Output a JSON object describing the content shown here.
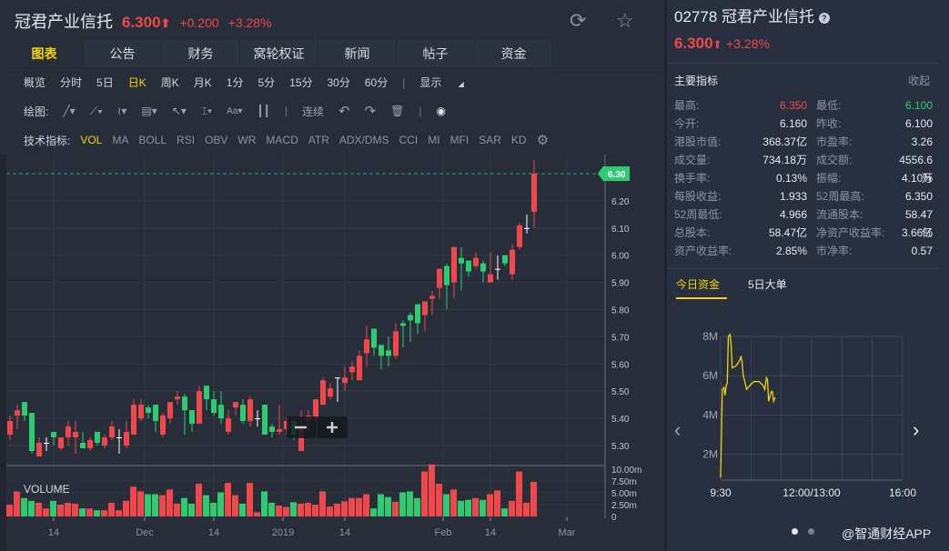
{
  "header": {
    "name": "冠君产业信托",
    "price": "6.300",
    "arrow": "⬆",
    "change": "+0.200",
    "pct": "+3.28%"
  },
  "tabs": [
    "图表",
    "公告",
    "财务",
    "窝轮权证",
    "新闻",
    "帖子",
    "资金"
  ],
  "periods": [
    "概览",
    "分时",
    "5日",
    "日K",
    "周K",
    "月K",
    "1分",
    "5分",
    "15分",
    "30分",
    "60分"
  ],
  "display_label": "显示",
  "draw": {
    "label": "绘图:",
    "continuous": "连续"
  },
  "indicators": {
    "label": "技术指标:",
    "items": [
      "VOL",
      "MA",
      "BOLL",
      "RSI",
      "OBV",
      "WR",
      "MACD",
      "ATR",
      "ADX/DMS",
      "CCI",
      "MI",
      "MFI",
      "SAR",
      "KD"
    ]
  },
  "colors": {
    "up": "#f0474a",
    "down": "#2ecc71",
    "accent": "#f5d200"
  },
  "chart_data": {
    "type": "candlestick",
    "current_price_tag": "6.30",
    "y_ticks": [
      "6.20",
      "6.10",
      "6.00",
      "5.90",
      "5.80",
      "5.70",
      "5.60",
      "5.50",
      "5.40",
      "5.30"
    ],
    "x_ticks": [
      {
        "label": "14",
        "at": 6
      },
      {
        "label": "Dec",
        "at": 18.5
      },
      {
        "label": "14",
        "at": 28
      },
      {
        "label": "2019",
        "at": 37.5
      },
      {
        "label": "14",
        "at": 46
      },
      {
        "label": "Feb",
        "at": 59.5
      },
      {
        "label": "14",
        "at": 66
      },
      {
        "label": "Mar",
        "at": 76.5
      }
    ],
    "volume_label": "VOLUME",
    "volume_ticks": [
      "10.00m",
      "7.50m",
      "5.00m",
      "2.50m",
      "0"
    ],
    "ohlc": [
      [
        5.34,
        5.41,
        5.32,
        5.39
      ],
      [
        5.41,
        5.45,
        5.36,
        5.43
      ],
      [
        5.46,
        5.46,
        5.39,
        5.41
      ],
      [
        5.42,
        5.42,
        5.27,
        5.28
      ],
      [
        5.26,
        5.33,
        5.26,
        5.31
      ],
      [
        5.31,
        5.33,
        5.28,
        5.31
      ],
      [
        5.35,
        5.35,
        5.3,
        5.33
      ],
      [
        5.29,
        5.33,
        5.28,
        5.33
      ],
      [
        5.33,
        5.39,
        5.3,
        5.37
      ],
      [
        5.33,
        5.39,
        5.27,
        5.35
      ],
      [
        5.31,
        5.35,
        5.29,
        5.29
      ],
      [
        5.29,
        5.33,
        5.28,
        5.32
      ],
      [
        5.35,
        5.35,
        5.3,
        5.31
      ],
      [
        5.3,
        5.34,
        5.29,
        5.33
      ],
      [
        5.33,
        5.39,
        5.32,
        5.37
      ],
      [
        5.33,
        5.36,
        5.27,
        5.33
      ],
      [
        5.3,
        5.39,
        5.29,
        5.35
      ],
      [
        5.34,
        5.47,
        5.34,
        5.45
      ],
      [
        5.4,
        5.47,
        5.39,
        5.45
      ],
      [
        5.44,
        5.45,
        5.4,
        5.42
      ],
      [
        5.45,
        5.45,
        5.35,
        5.39
      ],
      [
        5.34,
        5.42,
        5.33,
        5.41
      ],
      [
        5.4,
        5.46,
        5.38,
        5.46
      ],
      [
        5.47,
        5.5,
        5.45,
        5.48
      ],
      [
        5.48,
        5.49,
        5.34,
        5.43
      ],
      [
        5.43,
        5.43,
        5.35,
        5.38
      ],
      [
        5.38,
        5.52,
        5.38,
        5.5
      ],
      [
        5.52,
        5.52,
        5.43,
        5.47
      ],
      [
        5.47,
        5.5,
        5.41,
        5.42
      ],
      [
        5.45,
        5.5,
        5.38,
        5.4
      ],
      [
        5.35,
        5.43,
        5.34,
        5.4
      ],
      [
        5.44,
        5.46,
        5.41,
        5.46
      ],
      [
        5.45,
        5.47,
        5.38,
        5.39
      ],
      [
        5.39,
        5.48,
        5.37,
        5.47
      ],
      [
        5.4,
        5.43,
        5.37,
        5.4
      ],
      [
        5.45,
        5.45,
        5.34,
        5.34
      ],
      [
        5.37,
        5.38,
        5.33,
        5.35
      ],
      [
        5.35,
        5.45,
        5.34,
        5.36
      ],
      [
        5.36,
        5.4,
        5.34,
        5.39
      ],
      [
        5.39,
        5.4,
        5.32,
        5.34
      ],
      [
        5.28,
        5.43,
        5.28,
        5.36
      ],
      [
        5.39,
        5.43,
        5.36,
        5.41
      ],
      [
        5.4,
        5.47,
        5.39,
        5.47
      ],
      [
        5.45,
        5.55,
        5.45,
        5.54
      ],
      [
        5.48,
        5.53,
        5.47,
        5.51
      ],
      [
        5.55,
        5.55,
        5.46,
        5.55
      ],
      [
        5.53,
        5.59,
        5.5,
        5.55
      ],
      [
        5.57,
        5.61,
        5.54,
        5.59
      ],
      [
        5.54,
        5.65,
        5.54,
        5.63
      ],
      [
        5.64,
        5.74,
        5.59,
        5.69
      ],
      [
        5.73,
        5.73,
        5.63,
        5.66
      ],
      [
        5.67,
        5.67,
        5.58,
        5.63
      ],
      [
        5.65,
        5.7,
        5.59,
        5.63
      ],
      [
        5.63,
        5.75,
        5.62,
        5.72
      ],
      [
        5.75,
        5.76,
        5.66,
        5.74
      ],
      [
        5.78,
        5.79,
        5.68,
        5.76
      ],
      [
        5.82,
        5.82,
        5.71,
        5.75
      ],
      [
        5.78,
        5.83,
        5.72,
        5.83
      ],
      [
        5.84,
        5.87,
        5.78,
        5.85
      ],
      [
        5.88,
        5.95,
        5.84,
        5.95
      ],
      [
        5.96,
        5.97,
        5.8,
        5.89
      ],
      [
        5.9,
        6.03,
        5.84,
        6.03
      ],
      [
        5.99,
        6.03,
        5.87,
        5.97
      ],
      [
        5.98,
        5.98,
        5.92,
        5.94
      ],
      [
        5.96,
        6.01,
        5.95,
        5.99
      ],
      [
        5.97,
        5.98,
        5.9,
        5.94
      ],
      [
        5.9,
        6.01,
        5.9,
        5.93
      ],
      [
        5.95,
        6.0,
        5.91,
        5.95
      ],
      [
        6.0,
        6.0,
        5.96,
        5.97
      ],
      [
        5.93,
        6.04,
        5.91,
        6.02
      ],
      [
        6.03,
        6.12,
        6.02,
        6.11
      ],
      [
        6.1,
        6.15,
        6.08,
        6.1
      ],
      [
        6.16,
        6.35,
        6.1,
        6.3
      ]
    ],
    "volume_m": [
      2.5,
      5.3,
      3.9,
      3.3,
      2.9,
      1.7,
      3.3,
      2.5,
      2.9,
      2.7,
      1.7,
      1.7,
      1.3,
      1.3,
      2.9,
      1.3,
      3.3,
      6.3,
      5.3,
      4.7,
      4.7,
      4.5,
      5.7,
      2.7,
      3.9,
      2.7,
      6.9,
      4.5,
      2.9,
      5.1,
      7.1,
      4.5,
      2.7,
      7.1,
      0.9,
      5.3,
      2.9,
      2.3,
      2.0,
      3.0,
      2.7,
      2.9,
      2.5,
      5.3,
      2.1,
      2.7,
      3.2,
      3.9,
      3.9,
      4.7,
      1.7,
      4.7,
      4.1,
      3.1,
      5.1,
      5.3,
      3.9,
      9.5,
      11,
      6.9,
      4.7,
      5.7,
      3.3,
      3.5,
      3.9,
      3.5,
      4.7,
      5.5,
      1.7,
      3.3,
      9.5,
      2.9,
      7.3
    ]
  },
  "right": {
    "code": "02778",
    "name": "冠君产业信托",
    "price": "6.300",
    "arrow": "⬆",
    "pct": "+3.28%",
    "section_title": "主要指标",
    "collapse": "收起",
    "metrics": [
      [
        {
          "k": "最高:",
          "v": "6.350",
          "c": "up"
        },
        {
          "k": "最低:",
          "v": "6.100",
          "c": "down"
        }
      ],
      [
        {
          "k": "今开:",
          "v": "6.160"
        },
        {
          "k": "昨收:",
          "v": "6.100"
        }
      ],
      [
        {
          "k": "港股市值:",
          "v": "368.37亿"
        },
        {
          "k": "市盈率:",
          "v": "3.26"
        }
      ],
      [
        {
          "k": "成交量:",
          "v": "734.18万"
        },
        {
          "k": "成交额:",
          "v": "4556.6万"
        }
      ],
      [
        {
          "k": "换手率:",
          "v": "0.13%"
        },
        {
          "k": "振幅:",
          "v": "4.10%"
        }
      ],
      [
        {
          "k": "每股收益:",
          "v": "1.933"
        },
        {
          "k": "52周最高:",
          "v": "6.350"
        }
      ],
      [
        {
          "k": "52周最低:",
          "v": "4.966"
        },
        {
          "k": "流通股本:",
          "v": "58.47亿"
        }
      ],
      [
        {
          "k": "总股本:",
          "v": "58.47亿"
        },
        {
          "k": "净资产收益率:",
          "v": "3.66%"
        }
      ],
      [
        {
          "k": "资产收益率:",
          "v": "2.85%"
        },
        {
          "k": "市净率:",
          "v": "0.57"
        }
      ]
    ],
    "fund_tabs": [
      "今日资金",
      "5日大单"
    ],
    "fund_chart": {
      "type": "line",
      "y_ticks": [
        "8M",
        "6M",
        "4M",
        "2M"
      ],
      "x_ticks": [
        "9:30",
        "12:00/13:00",
        "16:00"
      ],
      "minutes": [
        0,
        3,
        6,
        8,
        10,
        12,
        14,
        17,
        19,
        21,
        28,
        35,
        37,
        39,
        41,
        43,
        47,
        53,
        60,
        70,
        77,
        80,
        83,
        85,
        87,
        92,
        94,
        96,
        99
      ],
      "values_m": [
        0.8,
        5.3,
        5.4,
        5.0,
        5.5,
        5.6,
        8.0,
        8.1,
        7.6,
        6.4,
        6.5,
        6.8,
        7.0,
        6.7,
        6.0,
        5.8,
        5.3,
        5.5,
        5.7,
        5.7,
        5.5,
        5.3,
        5.9,
        5.8,
        4.7,
        5.2,
        5.2,
        4.7,
        4.9
      ]
    },
    "watermark": "@智通财经APP"
  }
}
